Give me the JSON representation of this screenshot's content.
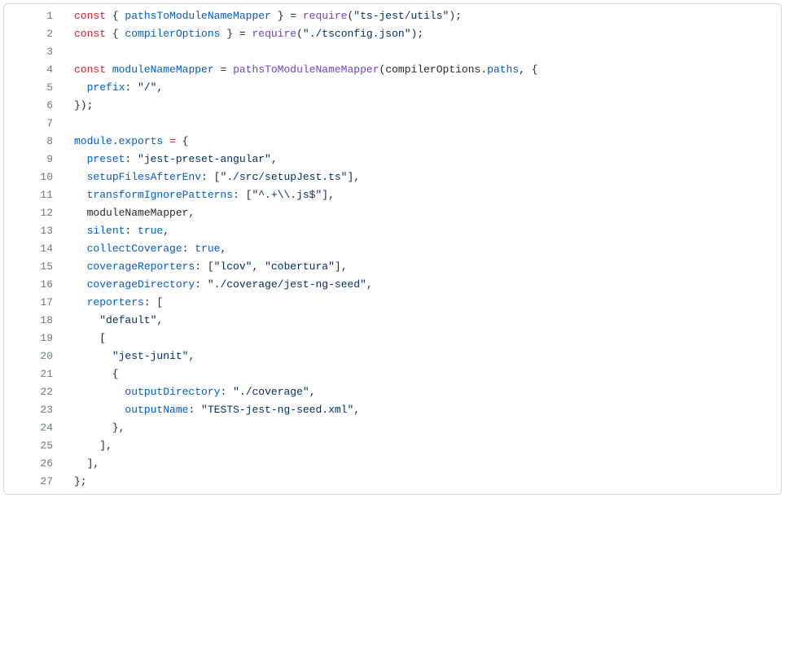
{
  "lines": [
    {
      "num": "1",
      "tokens": [
        {
          "t": "const",
          "c": "k"
        },
        {
          "t": " { ",
          "c": "c"
        },
        {
          "t": "pathsToModuleNameMapper",
          "c": "p"
        },
        {
          "t": " } = ",
          "c": "c"
        },
        {
          "t": "require",
          "c": "fn"
        },
        {
          "t": "(",
          "c": "c"
        },
        {
          "t": "\"ts-jest/utils\"",
          "c": "s"
        },
        {
          "t": ");",
          "c": "c"
        }
      ]
    },
    {
      "num": "2",
      "tokens": [
        {
          "t": "const",
          "c": "k"
        },
        {
          "t": " { ",
          "c": "c"
        },
        {
          "t": "compilerOptions",
          "c": "p"
        },
        {
          "t": " } = ",
          "c": "c"
        },
        {
          "t": "require",
          "c": "fn"
        },
        {
          "t": "(",
          "c": "c"
        },
        {
          "t": "\"./tsconfig.json\"",
          "c": "s"
        },
        {
          "t": ");",
          "c": "c"
        }
      ]
    },
    {
      "num": "3",
      "tokens": []
    },
    {
      "num": "4",
      "tokens": [
        {
          "t": "const",
          "c": "k"
        },
        {
          "t": " ",
          "c": "c"
        },
        {
          "t": "moduleNameMapper",
          "c": "p"
        },
        {
          "t": " = ",
          "c": "c"
        },
        {
          "t": "pathsToModuleNameMapper",
          "c": "fn"
        },
        {
          "t": "(",
          "c": "c"
        },
        {
          "t": "compilerOptions",
          "c": "c"
        },
        {
          "t": ".",
          "c": "c"
        },
        {
          "t": "paths",
          "c": "p"
        },
        {
          "t": ", {",
          "c": "c"
        }
      ]
    },
    {
      "num": "5",
      "tokens": [
        {
          "t": "  ",
          "c": "c"
        },
        {
          "t": "prefix",
          "c": "p"
        },
        {
          "t": ": ",
          "c": "c"
        },
        {
          "t": "\"/\"",
          "c": "s"
        },
        {
          "t": ",",
          "c": "c"
        }
      ]
    },
    {
      "num": "6",
      "tokens": [
        {
          "t": "});",
          "c": "c"
        }
      ]
    },
    {
      "num": "7",
      "tokens": []
    },
    {
      "num": "8",
      "tokens": [
        {
          "t": "module",
          "c": "p"
        },
        {
          "t": ".",
          "c": "c"
        },
        {
          "t": "exports",
          "c": "p"
        },
        {
          "t": " ",
          "c": "c"
        },
        {
          "t": "=",
          "c": "k"
        },
        {
          "t": " {",
          "c": "c"
        }
      ]
    },
    {
      "num": "9",
      "tokens": [
        {
          "t": "  ",
          "c": "c"
        },
        {
          "t": "preset",
          "c": "p"
        },
        {
          "t": ": ",
          "c": "c"
        },
        {
          "t": "\"jest-preset-angular\"",
          "c": "s"
        },
        {
          "t": ",",
          "c": "c"
        }
      ]
    },
    {
      "num": "10",
      "tokens": [
        {
          "t": "  ",
          "c": "c"
        },
        {
          "t": "setupFilesAfterEnv",
          "c": "p"
        },
        {
          "t": ": [",
          "c": "c"
        },
        {
          "t": "\"./src/setupJest.ts\"",
          "c": "s"
        },
        {
          "t": "],",
          "c": "c"
        }
      ]
    },
    {
      "num": "11",
      "tokens": [
        {
          "t": "  ",
          "c": "c"
        },
        {
          "t": "transformIgnorePatterns",
          "c": "p"
        },
        {
          "t": ": [",
          "c": "c"
        },
        {
          "t": "\"^.+\\\\.js$\"",
          "c": "s"
        },
        {
          "t": "],",
          "c": "c"
        }
      ]
    },
    {
      "num": "12",
      "tokens": [
        {
          "t": "  moduleNameMapper,",
          "c": "c"
        }
      ]
    },
    {
      "num": "13",
      "tokens": [
        {
          "t": "  ",
          "c": "c"
        },
        {
          "t": "silent",
          "c": "p"
        },
        {
          "t": ": ",
          "c": "c"
        },
        {
          "t": "true",
          "c": "p"
        },
        {
          "t": ",",
          "c": "c"
        }
      ]
    },
    {
      "num": "14",
      "tokens": [
        {
          "t": "  ",
          "c": "c"
        },
        {
          "t": "collectCoverage",
          "c": "p"
        },
        {
          "t": ": ",
          "c": "c"
        },
        {
          "t": "true",
          "c": "p"
        },
        {
          "t": ",",
          "c": "c"
        }
      ]
    },
    {
      "num": "15",
      "tokens": [
        {
          "t": "  ",
          "c": "c"
        },
        {
          "t": "coverageReporters",
          "c": "p"
        },
        {
          "t": ": [",
          "c": "c"
        },
        {
          "t": "\"lcov\"",
          "c": "s"
        },
        {
          "t": ", ",
          "c": "c"
        },
        {
          "t": "\"cobertura\"",
          "c": "s"
        },
        {
          "t": "],",
          "c": "c"
        }
      ]
    },
    {
      "num": "16",
      "tokens": [
        {
          "t": "  ",
          "c": "c"
        },
        {
          "t": "coverageDirectory",
          "c": "p"
        },
        {
          "t": ": ",
          "c": "c"
        },
        {
          "t": "\"./coverage/jest-ng-seed\"",
          "c": "s"
        },
        {
          "t": ",",
          "c": "c"
        }
      ]
    },
    {
      "num": "17",
      "tokens": [
        {
          "t": "  ",
          "c": "c"
        },
        {
          "t": "reporters",
          "c": "p"
        },
        {
          "t": ": [",
          "c": "c"
        }
      ]
    },
    {
      "num": "18",
      "tokens": [
        {
          "t": "    ",
          "c": "c"
        },
        {
          "t": "\"default\"",
          "c": "s"
        },
        {
          "t": ",",
          "c": "c"
        }
      ]
    },
    {
      "num": "19",
      "tokens": [
        {
          "t": "    [",
          "c": "c"
        }
      ]
    },
    {
      "num": "20",
      "tokens": [
        {
          "t": "      ",
          "c": "c"
        },
        {
          "t": "\"jest-junit\"",
          "c": "s"
        },
        {
          "t": ",",
          "c": "c"
        }
      ]
    },
    {
      "num": "21",
      "tokens": [
        {
          "t": "      {",
          "c": "c"
        }
      ]
    },
    {
      "num": "22",
      "tokens": [
        {
          "t": "        ",
          "c": "c"
        },
        {
          "t": "outputDirectory",
          "c": "p"
        },
        {
          "t": ": ",
          "c": "c"
        },
        {
          "t": "\"./coverage\"",
          "c": "s"
        },
        {
          "t": ",",
          "c": "c"
        }
      ]
    },
    {
      "num": "23",
      "tokens": [
        {
          "t": "        ",
          "c": "c"
        },
        {
          "t": "outputName",
          "c": "p"
        },
        {
          "t": ": ",
          "c": "c"
        },
        {
          "t": "\"TESTS-jest-ng-seed.xml\"",
          "c": "s"
        },
        {
          "t": ",",
          "c": "c"
        }
      ]
    },
    {
      "num": "24",
      "tokens": [
        {
          "t": "      },",
          "c": "c"
        }
      ]
    },
    {
      "num": "25",
      "tokens": [
        {
          "t": "    ],",
          "c": "c"
        }
      ]
    },
    {
      "num": "26",
      "tokens": [
        {
          "t": "  ],",
          "c": "c"
        }
      ]
    },
    {
      "num": "27",
      "tokens": [
        {
          "t": "};",
          "c": "c"
        }
      ]
    }
  ]
}
